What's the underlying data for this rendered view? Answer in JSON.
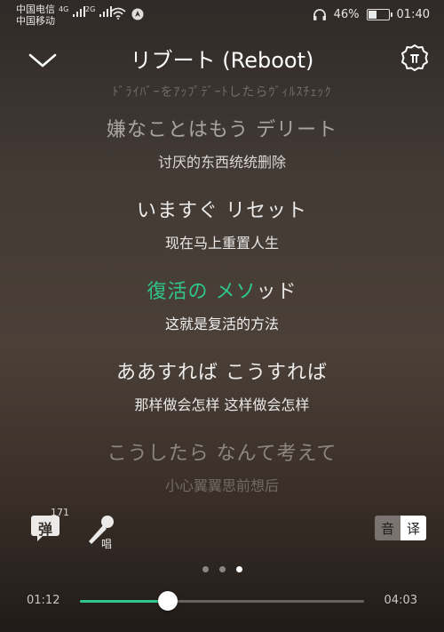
{
  "status_bar": {
    "carrier_1": "中国电信",
    "carrier_2": "中国移动",
    "signal_1_label": "4G",
    "signal_2_label": "2G",
    "battery_percent": "46%",
    "battery_level": 0.46,
    "time": "01:40"
  },
  "header": {
    "title": "リブート (Reboot)",
    "collapse_icon": "chevron-down-icon",
    "settings_icon": "settings-gear-icon"
  },
  "lyrics": {
    "accent_color": "#2fc58b",
    "faded_top": "ﾄﾞﾗｲﾊﾞｰをｱｯﾌﾟﾃﾞｰﾄしたらｳﾞｨﾙｽﾁｪｯｸ",
    "lines": [
      {
        "jp": "嫌なことはもう デリート",
        "cn": "讨厌的东西统统删除",
        "opacity": 0.55
      },
      {
        "jp": "いますぐ リセット",
        "cn": "现在马上重置人生",
        "opacity": 0.88
      },
      {
        "jp_played": "復活の メソ",
        "jp_rest": "ッド",
        "cn": "这就是复活的方法",
        "active": true
      },
      {
        "jp": "ああすれば こうすれば",
        "cn": "那样做会怎样 这样做会怎样",
        "opacity": 0.88
      },
      {
        "jp": "こうしたら なんて考えて",
        "cn": "小心翼翼思前想后",
        "opacity": 0.4
      }
    ]
  },
  "controls": {
    "danmaku_label": "弹",
    "danmaku_count": "171",
    "sing_label": "唱",
    "toggle_off_label": "音",
    "toggle_on_label": "译"
  },
  "pager": {
    "count": 3,
    "active_index": 2
  },
  "progress": {
    "elapsed": "01:12",
    "total": "04:03",
    "fraction": 0.31
  }
}
